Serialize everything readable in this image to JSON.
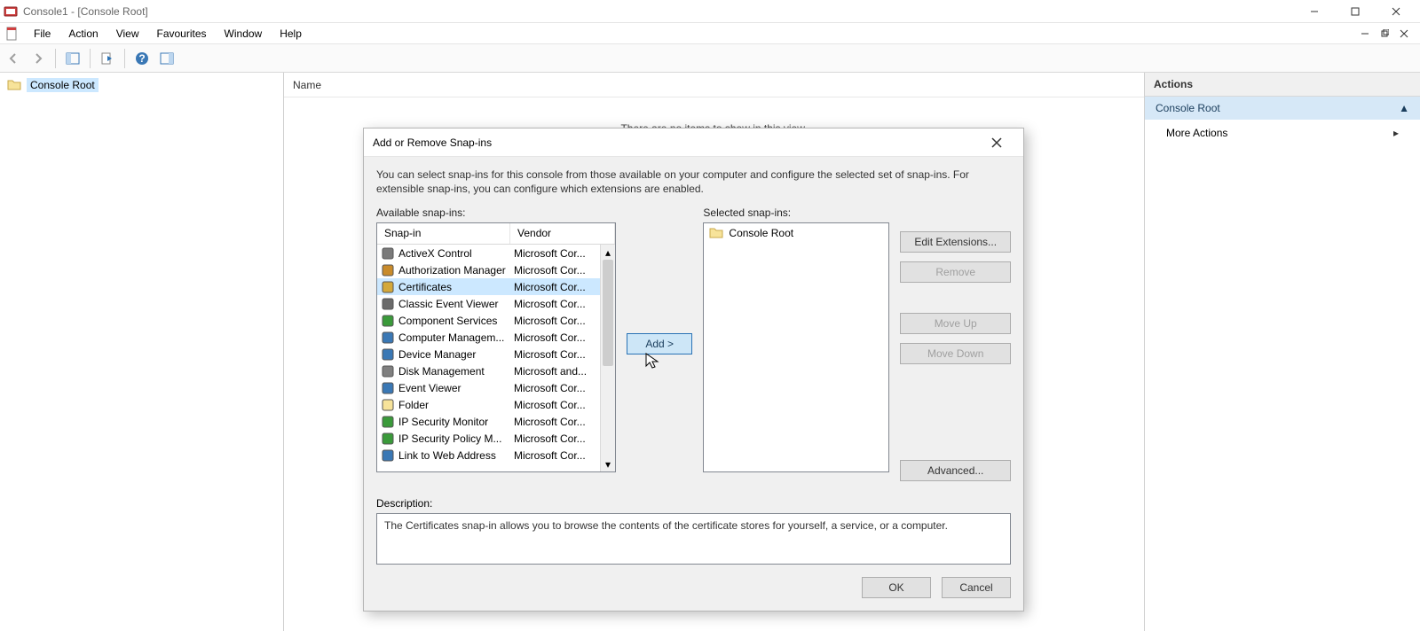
{
  "window": {
    "title": "Console1 - [Console Root]"
  },
  "menu": {
    "file": "File",
    "action": "Action",
    "view": "View",
    "favourites": "Favourites",
    "window": "Window",
    "help": "Help"
  },
  "tree": {
    "root": "Console Root"
  },
  "main": {
    "header_name": "Name",
    "empty_text": "There are no items to show in this view."
  },
  "actions": {
    "title": "Actions",
    "section": "Console Root",
    "more": "More Actions"
  },
  "dialog": {
    "title": "Add or Remove Snap-ins",
    "intro": "You can select snap-ins for this console from those available on your computer and configure the selected set of snap-ins. For extensible snap-ins, you can configure which extensions are enabled.",
    "available_label": "Available snap-ins:",
    "selected_label": "Selected snap-ins:",
    "col_snapin": "Snap-in",
    "col_vendor": "Vendor",
    "add": "Add >",
    "edit_ext": "Edit Extensions...",
    "remove": "Remove",
    "move_up": "Move Up",
    "move_down": "Move Down",
    "advanced": "Advanced...",
    "desc_label": "Description:",
    "desc_text": "The Certificates snap-in allows you to browse the contents of the certificate stores for yourself, a service, or a computer.",
    "ok": "OK",
    "cancel": "Cancel",
    "selected_root": "Console Root",
    "snapins": [
      {
        "name": "ActiveX Control",
        "vendor": "Microsoft Cor..."
      },
      {
        "name": "Authorization Manager",
        "vendor": "Microsoft Cor..."
      },
      {
        "name": "Certificates",
        "vendor": "Microsoft Cor...",
        "selected": true
      },
      {
        "name": "Classic Event Viewer",
        "vendor": "Microsoft Cor..."
      },
      {
        "name": "Component Services",
        "vendor": "Microsoft Cor..."
      },
      {
        "name": "Computer Managem...",
        "vendor": "Microsoft Cor..."
      },
      {
        "name": "Device Manager",
        "vendor": "Microsoft Cor..."
      },
      {
        "name": "Disk Management",
        "vendor": "Microsoft and..."
      },
      {
        "name": "Event Viewer",
        "vendor": "Microsoft Cor..."
      },
      {
        "name": "Folder",
        "vendor": "Microsoft Cor..."
      },
      {
        "name": "IP Security Monitor",
        "vendor": "Microsoft Cor..."
      },
      {
        "name": "IP Security Policy M...",
        "vendor": "Microsoft Cor..."
      },
      {
        "name": "Link to Web Address",
        "vendor": "Microsoft Cor..."
      }
    ]
  }
}
